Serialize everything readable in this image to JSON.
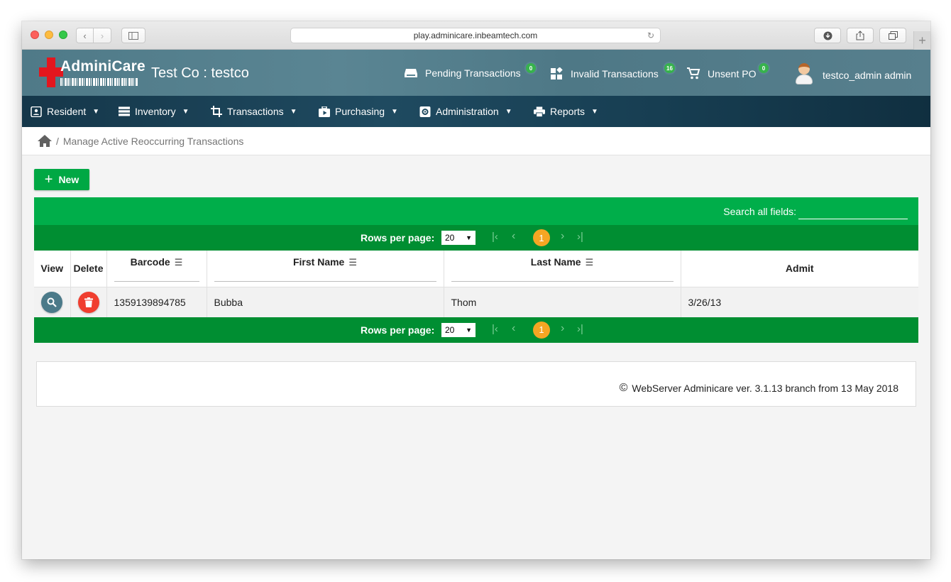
{
  "browser": {
    "url": "play.adminicare.inbeamtech.com",
    "back_glyph": "‹",
    "forward_glyph": "›",
    "plus_glyph": "+"
  },
  "header": {
    "logo_text": "AdminiCare",
    "company": "Test Co : testco",
    "pending": {
      "label": "Pending Transactions",
      "count": "0",
      "icon": "inbox-icon"
    },
    "invalid": {
      "label": "Invalid Transactions",
      "count": "16",
      "icon": "widgets-icon"
    },
    "unsent": {
      "label": "Unsent PO",
      "count": "0",
      "icon": "cart-icon"
    },
    "user": "testco_admin admin",
    "badge_color": "#37b24d"
  },
  "menu": {
    "resident": "Resident",
    "inventory": "Inventory",
    "transactions": "Transactions",
    "purchasing": "Purchasing",
    "administration": "Administration",
    "reports": "Reports"
  },
  "breadcrumb": {
    "separator": "/",
    "page": "Manage Active Reoccurring Transactions"
  },
  "toolbar": {
    "new_label": "New"
  },
  "table": {
    "search_label": "Search all fields:",
    "search_value": "",
    "rows_per_page_label": "Rows per page:",
    "rows_per_page_value": "20",
    "current_page": "1",
    "columns": {
      "view": "View",
      "delete": "Delete",
      "barcode": "Barcode",
      "first_name": "First Name",
      "last_name": "Last Name",
      "admit": "Admit"
    },
    "rows": [
      {
        "barcode": "1359139894785",
        "first_name": "Bubba",
        "last_name": "Thom",
        "admit": "3/26/13"
      }
    ]
  },
  "footer": {
    "text": "WebServer Adminicare ver. 3.1.13 branch from 13 May 2018"
  },
  "colors": {
    "header_bg": "#5a8593",
    "menu_bg": "#1f4a60",
    "green": "#00ae4a",
    "dark_green": "#008e32",
    "page_badge": "#f5a623",
    "delete_red": "#f03e2f"
  }
}
